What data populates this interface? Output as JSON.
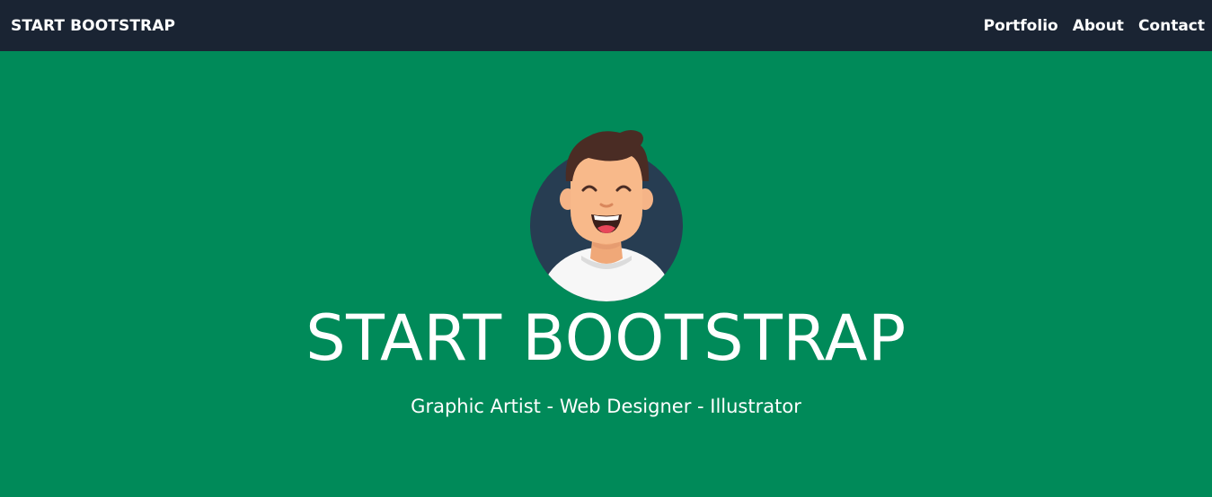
{
  "navbar": {
    "brand": "START BOOTSTRAP",
    "links": [
      {
        "label": "Portfolio"
      },
      {
        "label": "About"
      },
      {
        "label": "Contact"
      }
    ]
  },
  "masthead": {
    "title": "START BOOTSTRAP",
    "subtitle": "Graphic Artist - Web Designer - Illustrator",
    "avatar_icon": "avatar-illustration"
  },
  "colors": {
    "navbar_bg": "#1a2433",
    "masthead_bg": "#008a59",
    "avatar_circle": "#273d52",
    "text": "#ffffff"
  }
}
